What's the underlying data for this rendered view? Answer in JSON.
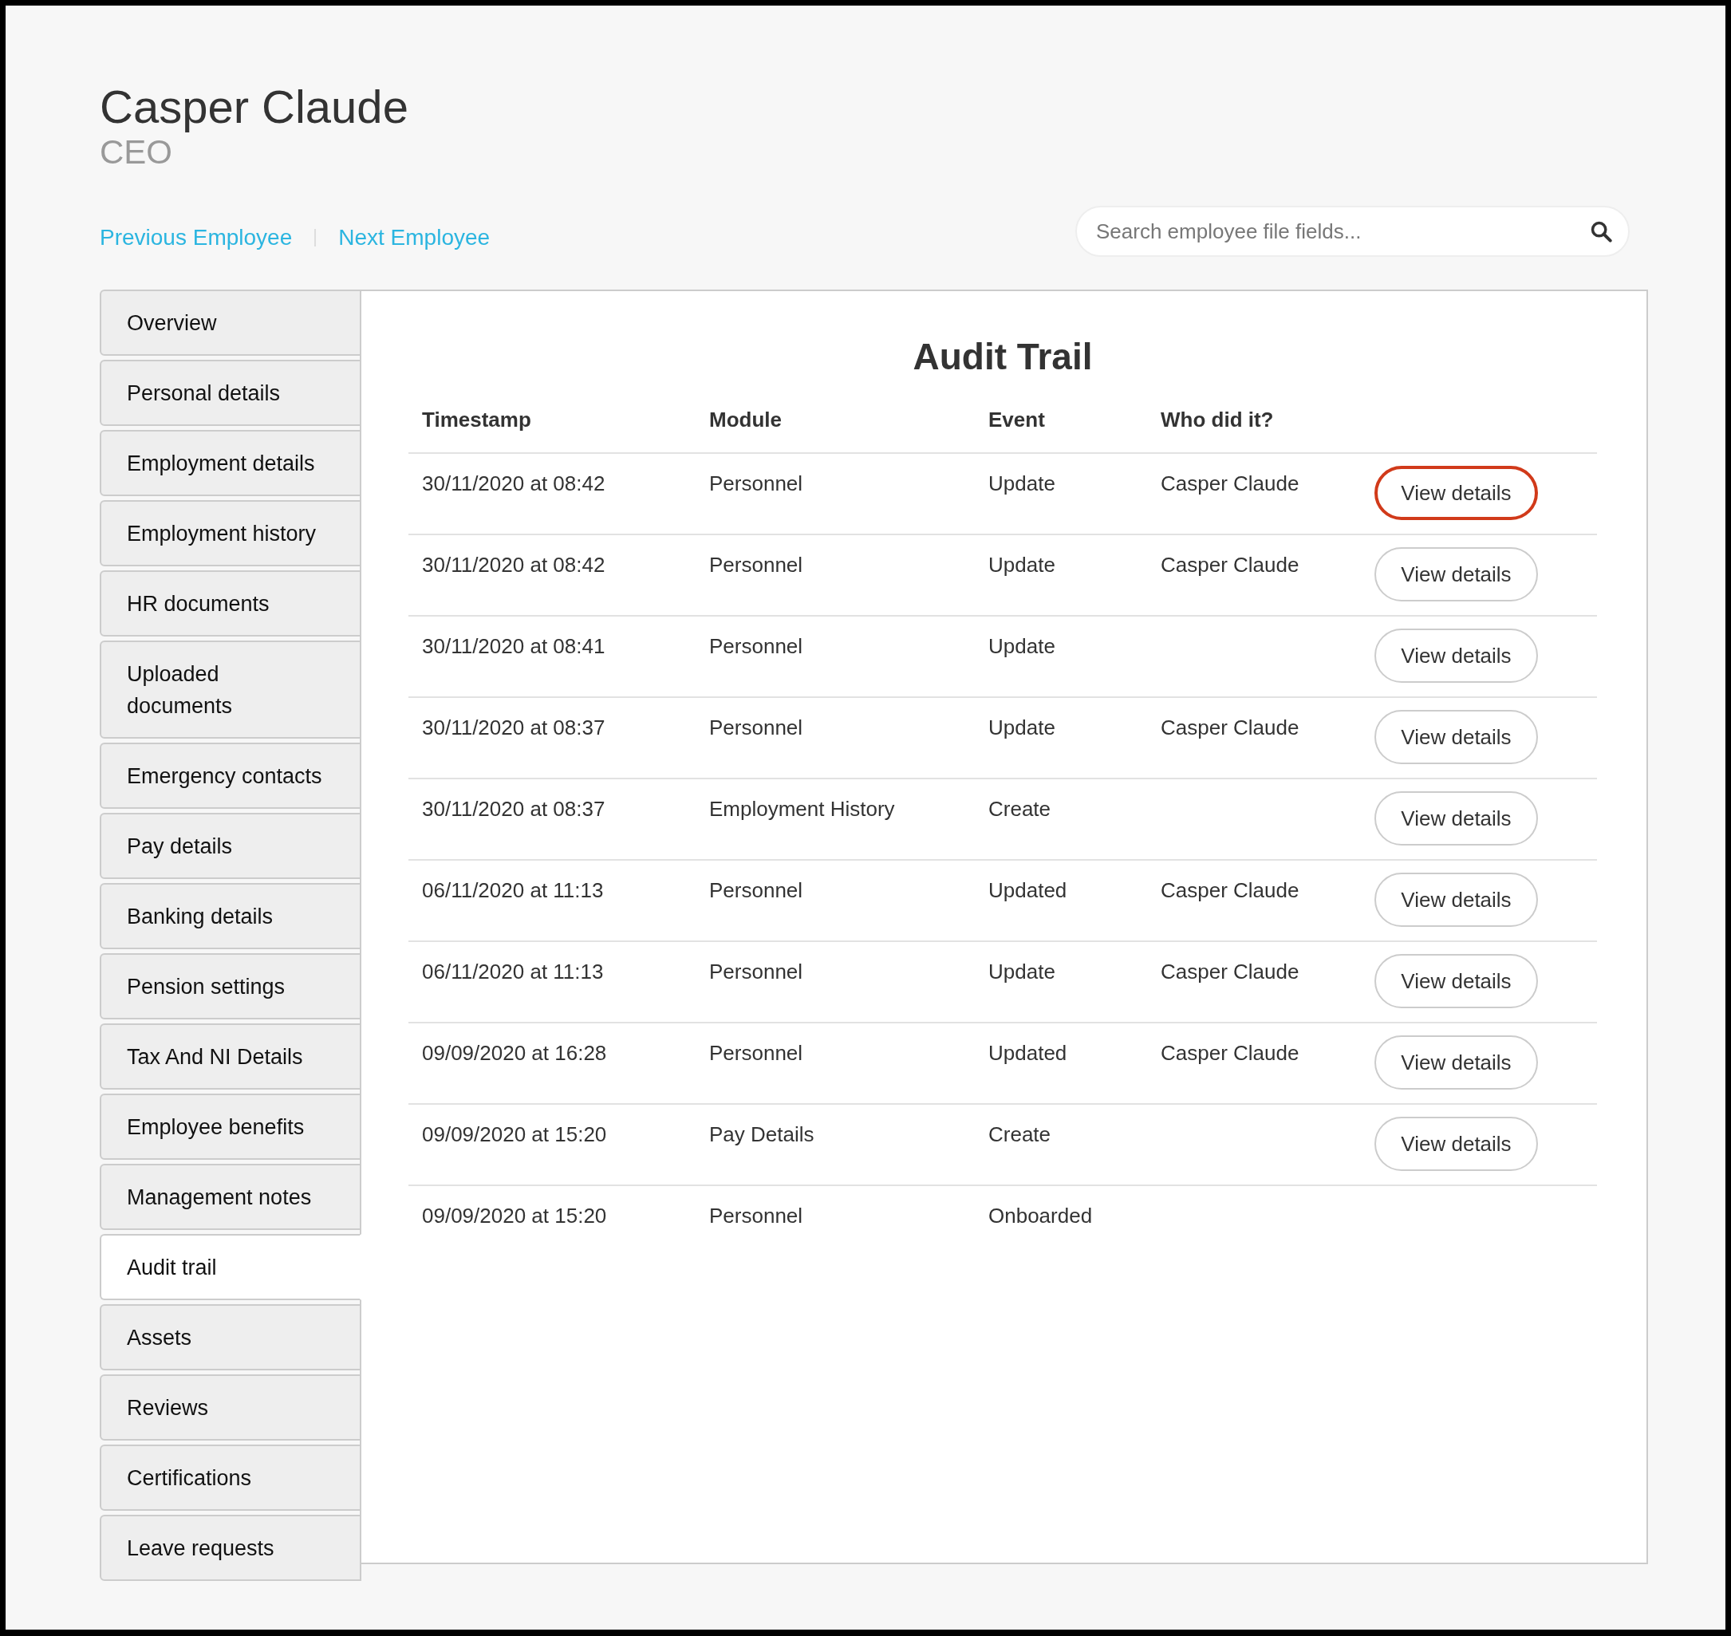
{
  "employee": {
    "name": "Casper Claude",
    "role": "CEO"
  },
  "nav_links": [
    {
      "label": "Previous Employee"
    },
    {
      "label": "Next Employee"
    }
  ],
  "search": {
    "placeholder": "Search employee file fields..."
  },
  "sidebar": {
    "items": [
      {
        "label": "Overview",
        "selected": false
      },
      {
        "label": "Personal details",
        "selected": false
      },
      {
        "label": "Employment details",
        "selected": false
      },
      {
        "label": "Employment history",
        "selected": false
      },
      {
        "label": "HR documents",
        "selected": false
      },
      {
        "label": "Uploaded documents",
        "selected": false
      },
      {
        "label": "Emergency contacts",
        "selected": false
      },
      {
        "label": "Pay details",
        "selected": false
      },
      {
        "label": "Banking details",
        "selected": false
      },
      {
        "label": "Pension settings",
        "selected": false
      },
      {
        "label": "Tax And NI Details",
        "selected": false
      },
      {
        "label": "Employee benefits",
        "selected": false
      },
      {
        "label": "Management notes",
        "selected": false
      },
      {
        "label": "Audit trail",
        "selected": true
      },
      {
        "label": "Assets",
        "selected": false
      },
      {
        "label": "Reviews",
        "selected": false
      },
      {
        "label": "Certifications",
        "selected": false
      },
      {
        "label": "Leave requests",
        "selected": false
      }
    ]
  },
  "audit_trail": {
    "title": "Audit Trail",
    "columns": [
      "Timestamp",
      "Module",
      "Event",
      "Who did it?"
    ],
    "rows": [
      {
        "timestamp": "30/11/2020 at 08:42",
        "module": "Personnel",
        "event": "Update",
        "who": "Casper Claude",
        "action": {
          "label": "View details",
          "highlighted": true
        }
      },
      {
        "timestamp": "30/11/2020 at 08:42",
        "module": "Personnel",
        "event": "Update",
        "who": "Casper Claude",
        "action": {
          "label": "View details",
          "highlighted": false
        }
      },
      {
        "timestamp": "30/11/2020 at 08:41",
        "module": "Personnel",
        "event": "Update",
        "action": {
          "label": "View details",
          "highlighted": false
        }
      },
      {
        "timestamp": "30/11/2020 at 08:37",
        "module": "Personnel",
        "event": "Update",
        "who": "Casper Claude",
        "action": {
          "label": "View details",
          "highlighted": false
        }
      },
      {
        "timestamp": "30/11/2020 at 08:37",
        "module": "Employment History",
        "event": "Create",
        "action": {
          "label": "View details",
          "highlighted": false
        }
      },
      {
        "timestamp": "06/11/2020 at 11:13",
        "module": "Personnel",
        "event": "Updated",
        "who": "Casper Claude",
        "action": {
          "label": "View details",
          "highlighted": false
        }
      },
      {
        "timestamp": "06/11/2020 at 11:13",
        "module": "Personnel",
        "event": "Update",
        "who": "Casper Claude",
        "action": {
          "label": "View details",
          "highlighted": false
        }
      },
      {
        "timestamp": "09/09/2020 at 16:28",
        "module": "Personnel",
        "event": "Updated",
        "who": "Casper Claude",
        "action": {
          "label": "View details",
          "highlighted": false
        }
      },
      {
        "timestamp": "09/09/2020 at 15:20",
        "module": "Pay Details",
        "event": "Create",
        "action": {
          "label": "View details",
          "highlighted": false
        }
      },
      {
        "timestamp": "09/09/2020 at 15:20",
        "module": "Personnel",
        "event": "Onboarded"
      }
    ]
  }
}
